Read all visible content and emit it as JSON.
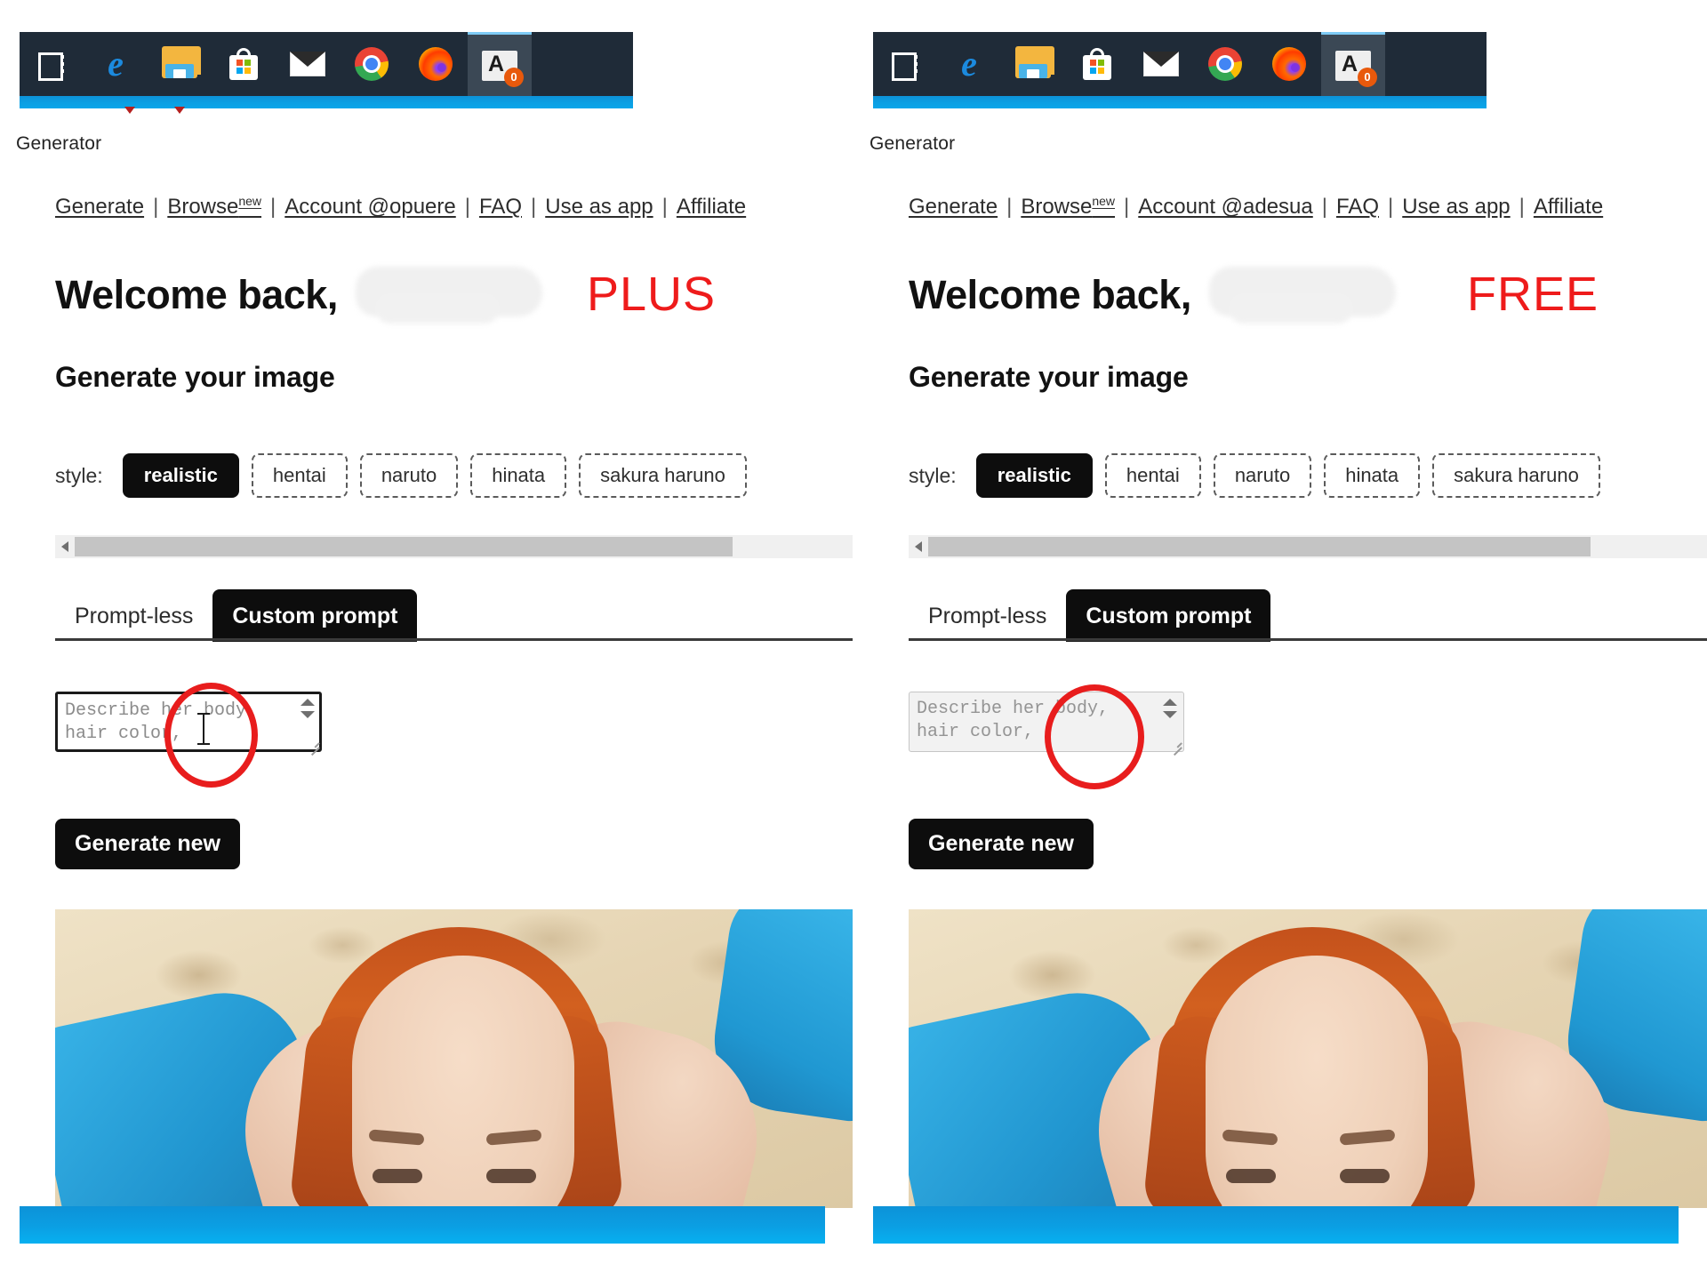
{
  "comparison": {
    "layout": "side-by-side-screenshot-comparison",
    "left_label": "PLUS",
    "right_label": "FREE"
  },
  "taskbar": {
    "icons": [
      {
        "name": "task-view-icon",
        "label": "Task View"
      },
      {
        "name": "edge-icon",
        "label": "Microsoft Edge",
        "glyph": "e"
      },
      {
        "name": "file-explorer-icon",
        "label": "File Explorer"
      },
      {
        "name": "microsoft-store-icon",
        "label": "Microsoft Store"
      },
      {
        "name": "mail-icon",
        "label": "Mail"
      },
      {
        "name": "chrome-icon",
        "label": "Google Chrome"
      },
      {
        "name": "firefox-icon",
        "label": "Mozilla Firefox"
      },
      {
        "name": "app-icon",
        "label": "A",
        "badge": "0"
      }
    ]
  },
  "panels": [
    {
      "id": "left",
      "plan": "PLUS",
      "site_label": "Generator",
      "nav": [
        {
          "label": "Generate",
          "badge": ""
        },
        {
          "label": "Browse",
          "badge": "new"
        },
        {
          "label": "Account @opuere",
          "badge": ""
        },
        {
          "label": "FAQ",
          "badge": ""
        },
        {
          "label": "Use as app",
          "badge": ""
        },
        {
          "label": "Affiliate",
          "badge": ""
        }
      ],
      "welcome": "Welcome back,",
      "subtitle": "Generate your image",
      "style": {
        "label": "style:",
        "selected": "realistic",
        "options": [
          "realistic",
          "hentai",
          "naruto",
          "hinata",
          "sakura haruno"
        ]
      },
      "tabs": [
        {
          "label": "Prompt-less",
          "active": false
        },
        {
          "label": "Custom prompt",
          "active": true
        }
      ],
      "prompt": {
        "placeholder": "Describe her body,\nhair color,",
        "value": "",
        "state": "enabled-focused"
      },
      "generate_button": "Generate new",
      "cursor": "text-ibeam",
      "annotation": "red-ellipse-on-prompt-field"
    },
    {
      "id": "right",
      "plan": "FREE",
      "site_label": "Generator",
      "nav": [
        {
          "label": "Generate",
          "badge": ""
        },
        {
          "label": "Browse",
          "badge": "new"
        },
        {
          "label": "Account @adesua",
          "badge": ""
        },
        {
          "label": "FAQ",
          "badge": ""
        },
        {
          "label": "Use as app",
          "badge": ""
        },
        {
          "label": "Affiliate",
          "badge": ""
        }
      ],
      "welcome": "Welcome back,",
      "subtitle": "Generate your image",
      "style": {
        "label": "style:",
        "selected": "realistic",
        "options": [
          "realistic",
          "hentai",
          "naruto",
          "hinata",
          "sakura haruno"
        ]
      },
      "tabs": [
        {
          "label": "Prompt-less",
          "active": false
        },
        {
          "label": "Custom prompt",
          "active": true
        }
      ],
      "prompt": {
        "placeholder": "Describe her body,\nhair color,",
        "value": "",
        "state": "disabled"
      },
      "generate_button": "Generate new",
      "cursor": "arrow",
      "annotation": "red-ellipse-on-prompt-field"
    }
  ],
  "colors": {
    "accent_blue": "#0b9fe3",
    "taskbar": "#1f2b38",
    "annotation_red": "#e81d1d",
    "plan_text_red": "#ee1b1b",
    "button_black": "#0d0d0d"
  }
}
